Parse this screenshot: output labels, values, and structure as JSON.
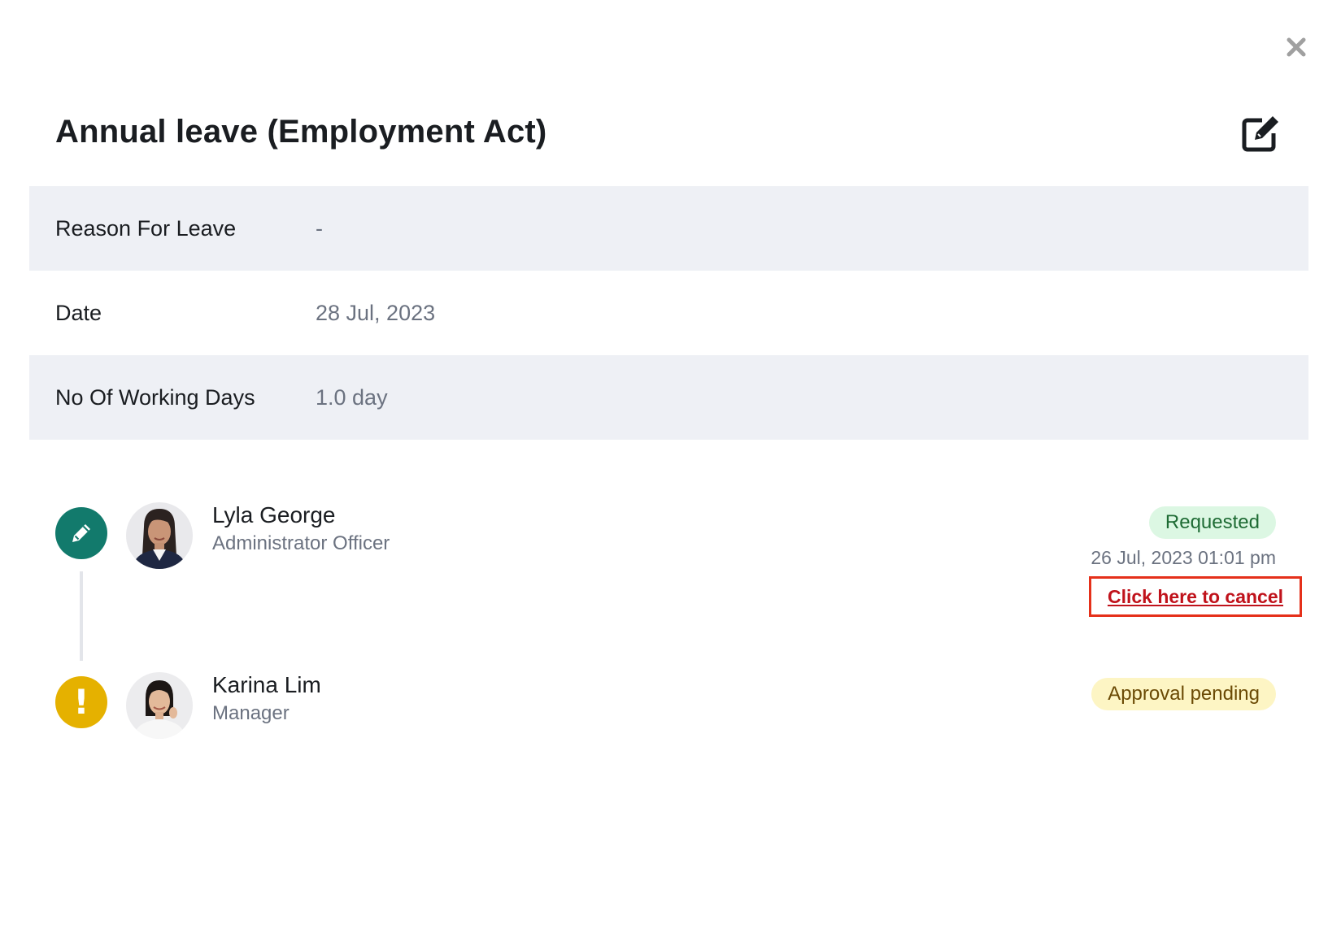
{
  "modal": {
    "title": "Annual leave (Employment Act)",
    "close_icon": "close-icon",
    "edit_icon": "edit-icon"
  },
  "details": [
    {
      "label": "Reason For Leave",
      "value": "-"
    },
    {
      "label": "Date",
      "value": "28 Jul, 2023"
    },
    {
      "label": "No Of Working Days",
      "value": "1.0 day"
    }
  ],
  "timeline": [
    {
      "name": "Lyla George",
      "role": "Administrator Officer",
      "icon": "pencil-icon",
      "status": "Requested",
      "timestamp": "26 Jul, 2023 01:01 pm",
      "action": "Click here to cancel"
    },
    {
      "name": "Karina Lim",
      "role": "Manager",
      "icon": "exclamation-icon",
      "status": "Approval pending"
    }
  ],
  "colors": {
    "teal": "#127a6c",
    "amber": "#e5b100",
    "requested_bg": "#dcf7e3",
    "pending_bg": "#fdf5c4",
    "cancel_red": "#c0121b",
    "highlight_border": "#e5301a"
  }
}
